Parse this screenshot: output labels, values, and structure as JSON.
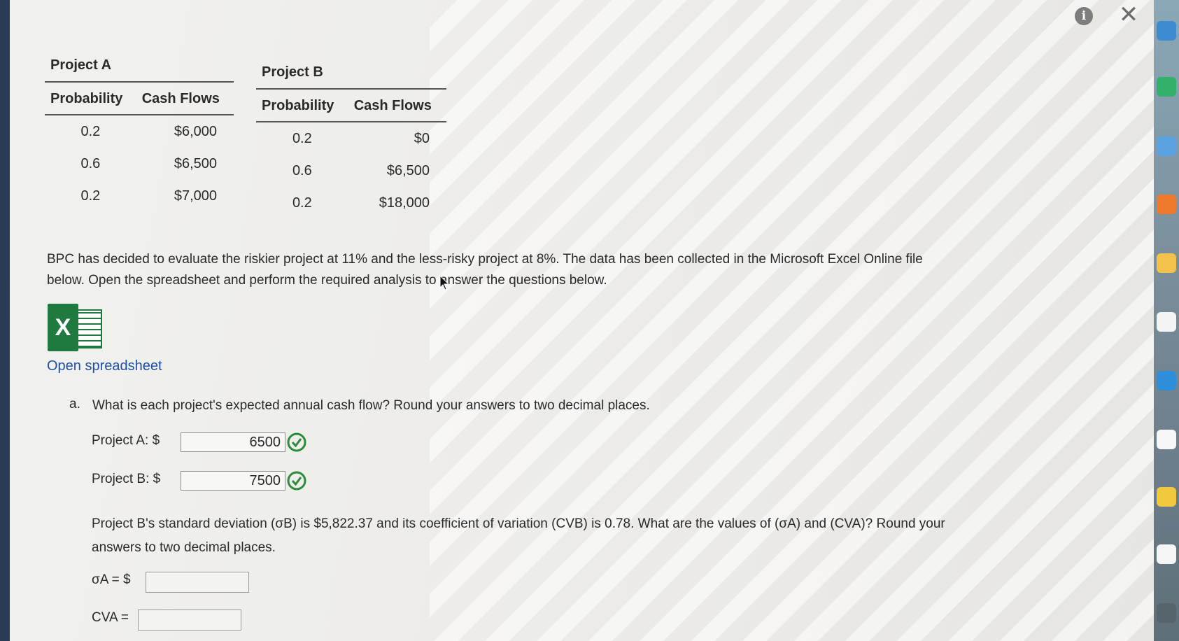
{
  "header": {
    "info_icon": "i",
    "close_icon": "✕"
  },
  "project_a": {
    "title": "Project A",
    "col_probability": "Probability",
    "col_cash_flows": "Cash Flows",
    "rows": [
      {
        "probability": "0.2",
        "cash_flow": "$6,000"
      },
      {
        "probability": "0.6",
        "cash_flow": "$6,500"
      },
      {
        "probability": "0.2",
        "cash_flow": "$7,000"
      }
    ]
  },
  "project_b": {
    "title": "Project B",
    "col_probability": "Probability",
    "col_cash_flows": "Cash Flows",
    "rows": [
      {
        "probability": "0.2",
        "cash_flow": "$0"
      },
      {
        "probability": "0.6",
        "cash_flow": "$6,500"
      },
      {
        "probability": "0.2",
        "cash_flow": "$18,000"
      }
    ]
  },
  "intro": {
    "line1": "BPC has decided to evaluate the riskier project at 11% and the less-risky project at 8%. The data has been collected in the Microsoft Excel Online file",
    "line2": "below. Open the spreadsheet and perform the required analysis to answer the questions below."
  },
  "spreadsheet": {
    "icon_letter": "X",
    "link_text": "Open spreadsheet"
  },
  "question_a": {
    "letter": "a.",
    "text": "What is each project's expected annual cash flow? Round your answers to two decimal places.",
    "project_a_label": "Project A: $",
    "project_a_value": "6500",
    "project_b_label": "Project B: $",
    "project_b_value": "7500",
    "followup_line1": "Project B's standard deviation (σB) is $5,822.37 and its coefficient of variation (CVB) is 0.78. What are the values of (σA) and (CVA)? Round your",
    "followup_line2": "answers to two decimal places.",
    "sigma_label": "σA = $",
    "cv_label": "CVA ="
  },
  "colors": {
    "accent_green": "#2e8a3e",
    "link_blue": "#1d4fa6",
    "excel_green": "#1f7a3f"
  }
}
